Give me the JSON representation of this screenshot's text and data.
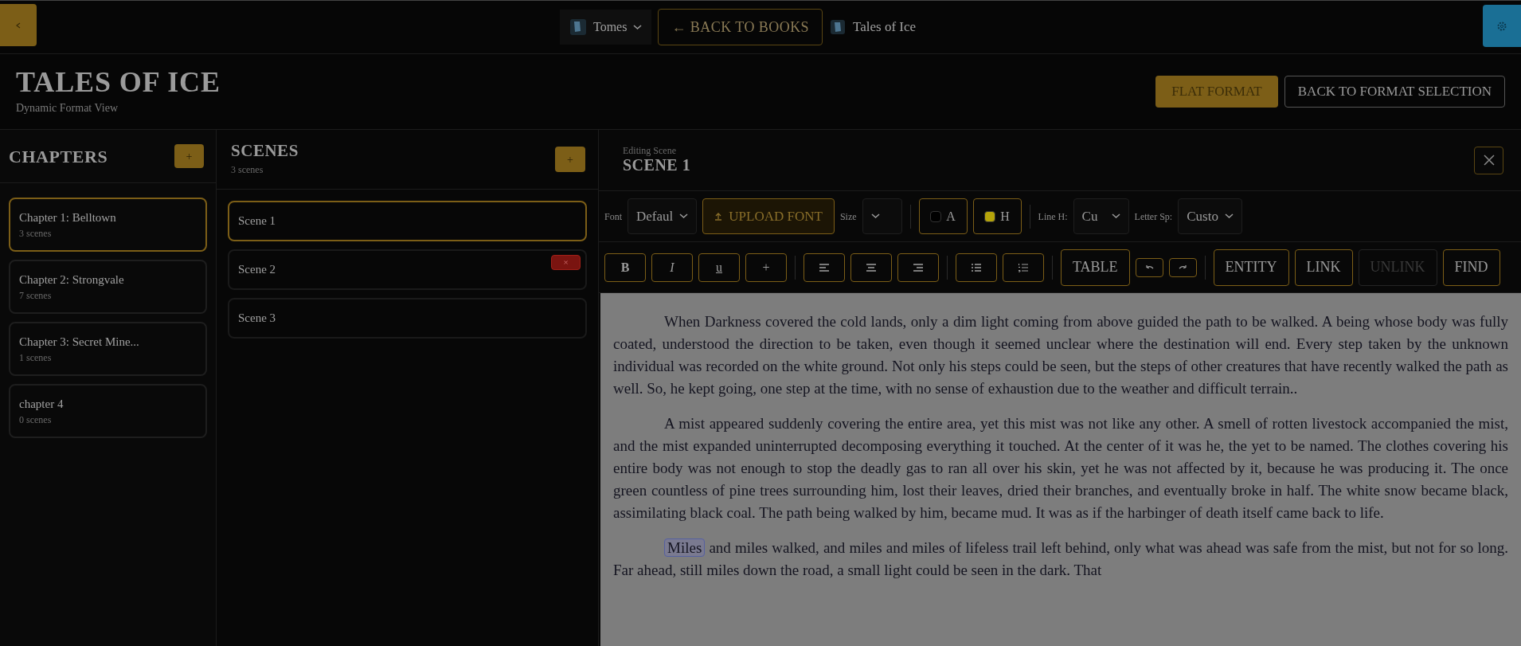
{
  "top_bar": {
    "library": "Tomes",
    "back_button": "← BACK TO BOOKS",
    "book": "Tales of Ice"
  },
  "header": {
    "title": "TALES OF ICE",
    "subtitle": "Dynamic Format View",
    "buttons": [
      {
        "label": "FLAT FORMAT",
        "selected": true
      },
      {
        "label": "BACK TO FORMAT SELECTION",
        "selected": false
      }
    ]
  },
  "chapters": {
    "title": "CHAPTERS",
    "add_button": "+",
    "items": [
      {
        "name": "Chapter 1: Belltown",
        "count": "3 scenes",
        "selected": true
      },
      {
        "name": "Chapter 2: Strongvale",
        "count": "7 scenes",
        "selected": false
      },
      {
        "name": "Chapter 3: Secret Mine...",
        "count": "1 scenes",
        "selected": false
      },
      {
        "name": "chapter 4",
        "count": "0 scenes",
        "selected": false
      }
    ]
  },
  "scenes": {
    "title": "SCENES",
    "count": "3 scenes",
    "add_button": "+",
    "items": [
      {
        "name": "Scene 1",
        "selected": true
      },
      {
        "name": "Scene 2",
        "selected": false,
        "delete_button": "×"
      },
      {
        "name": "Scene 3",
        "selected": false
      }
    ]
  },
  "editor": {
    "caption": "Editing Scene",
    "title": "SCENE 1",
    "toolbar_rows": [
      [
        [
          {
            "kind": "label",
            "text": "Font"
          },
          {
            "kind": "select",
            "value": "Defaul"
          },
          {
            "kind": "upload",
            "text": "UPLOAD FONT"
          },
          {
            "kind": "label",
            "text": "Size"
          },
          {
            "kind": "select"
          }
        ],
        [
          {
            "kind": "color",
            "text": "A",
            "color": "#000000"
          },
          {
            "kind": "color",
            "text": "H",
            "color": "#b5a40a"
          }
        ],
        [
          {
            "kind": "label",
            "text": "Line H:"
          },
          {
            "kind": "select",
            "value": "Cu"
          },
          {
            "kind": "label",
            "text": "Letter Sp:"
          },
          {
            "kind": "select",
            "value": "Custo"
          }
        ]
      ],
      [
        [
          {
            "kind": "bold",
            "text": "B"
          },
          {
            "kind": "italic",
            "text": "I"
          },
          {
            "kind": "underline",
            "text": "u"
          },
          {
            "kind": "plain",
            "text": "+"
          }
        ],
        [
          {
            "kind": "align_left"
          },
          {
            "kind": "align_center"
          },
          {
            "kind": "align_right"
          }
        ],
        [
          {
            "kind": "bullet_list"
          },
          {
            "kind": "number_list"
          }
        ],
        [
          {
            "kind": "text",
            "text": "TABLE",
            "disabled": false
          },
          {
            "kind": "undo"
          },
          {
            "kind": "redo"
          }
        ],
        [
          {
            "kind": "text",
            "text": "ENTITY",
            "disabled": false
          },
          {
            "kind": "text",
            "text": "LINK",
            "disabled": false
          },
          {
            "kind": "text",
            "text": "UNLINK",
            "disabled": true
          },
          {
            "kind": "text",
            "text": "FIND",
            "disabled": false
          }
        ]
      ]
    ],
    "paragraphs": [
      [
        {
          "kind": "text",
          "text": "When Darkness covered the cold lands, only a dim light coming from above guided the path to be walked. A being whose body was fully coated, understood the direction to be taken, even though it seemed unclear where the destination will end. Every step taken by the unknown individual was recorded on the white ground. Not only his steps could be seen, but the steps of other creatures that have recently walked the path as well. So, he kept going, one step at the time, with no sense of exhaustion due to the weather and difficult terrain.."
        }
      ],
      [
        {
          "kind": "text",
          "text": "A mist appeared suddenly covering the entire area, yet this mist was not like any other. A smell of rotten livestock accompanied the mist, and the mist expanded uninterrupted decomposing everything it touched. At the center of it was he, the yet to be named. The clothes covering his entire body was not enough to stop the deadly gas to ran all over his skin, yet he was not affected by it, because he was producing it. The once green countless of pine trees surrounding him, lost their leaves, dried their branches, and eventually broke in half. The white snow became black, assimilating black coal. The path being walked by him, became mud. It was as if the harbinger of death itself came back to life."
        }
      ],
      [
        {
          "kind": "entity",
          "text": "Miles"
        },
        {
          "kind": "text",
          "text": " and miles walked, and miles and miles of lifeless trail left behind, only what was ahead was safe from the mist, but not for so long. Far ahead, still miles down the road, a small light could be seen in the dark. That"
        }
      ]
    ]
  }
}
